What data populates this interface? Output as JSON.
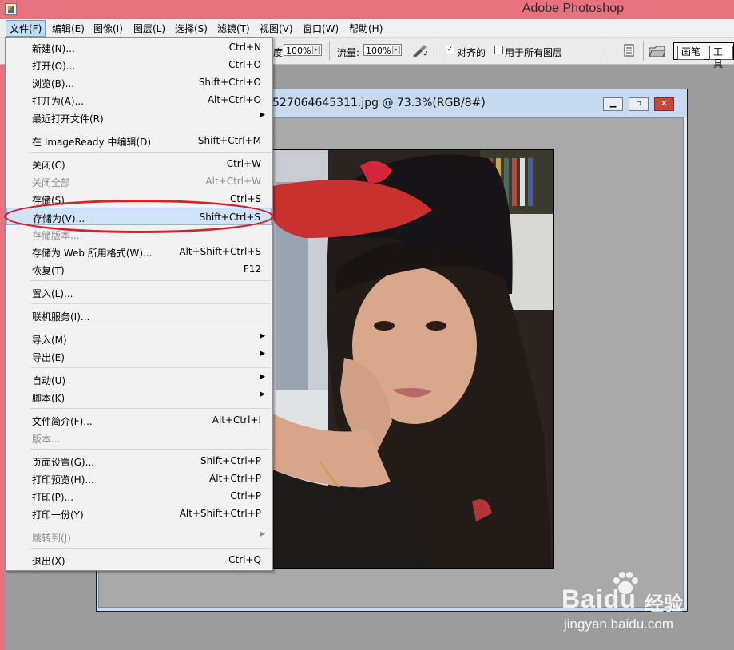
{
  "window": {
    "title": "Adobe Photoshop"
  },
  "menubar": [
    "文件(F)",
    "编辑(E)",
    "图像(I)",
    "图层(L)",
    "选择(S)",
    "滤镜(T)",
    "视图(V)",
    "窗口(W)",
    "帮助(H)"
  ],
  "options": {
    "opacity_label_fragment": "度:",
    "opacity_value": "100%",
    "flow_label": "流量:",
    "flow_value": "100%",
    "aligned_label": "对齐的",
    "aligned_checked": true,
    "all_layers_label": "用于所有图层",
    "all_layers_checked": false,
    "tabs": [
      "画笔",
      "工具"
    ]
  },
  "document": {
    "title": "527064645311.jpg @ 73.3%(RGB/8#)",
    "minimize_icon": "minimize-icon",
    "maximize_icon": "maximize-icon",
    "close_icon": "close-icon"
  },
  "file_menu": {
    "items": [
      {
        "label": "新建(N)...",
        "shortcut": "Ctrl+N"
      },
      {
        "label": "打开(O)...",
        "shortcut": "Ctrl+O"
      },
      {
        "label": "浏览(B)...",
        "shortcut": "Shift+Ctrl+O"
      },
      {
        "label": "打开为(A)...",
        "shortcut": "Alt+Ctrl+O"
      },
      {
        "label": "最近打开文件(R)",
        "shortcut": ""
      },
      {
        "label": "在 ImageReady 中编辑(D)",
        "shortcut": "Shift+Ctrl+M"
      },
      {
        "label": "关闭(C)",
        "shortcut": "Ctrl+W"
      },
      {
        "label": "关闭全部",
        "shortcut": "Alt+Ctrl+W"
      },
      {
        "label": "存储(S)",
        "shortcut": "Ctrl+S"
      },
      {
        "label": "存储为(V)...",
        "shortcut": "Shift+Ctrl+S"
      },
      {
        "label": "存储版本...",
        "shortcut": ""
      },
      {
        "label": "存储为 Web 所用格式(W)...",
        "shortcut": "Alt+Shift+Ctrl+S"
      },
      {
        "label": "恢复(T)",
        "shortcut": "F12"
      },
      {
        "label": "置入(L)...",
        "shortcut": ""
      },
      {
        "label": "联机服务(I)...",
        "shortcut": ""
      },
      {
        "label": "导入(M)",
        "shortcut": ""
      },
      {
        "label": "导出(E)",
        "shortcut": ""
      },
      {
        "label": "自动(U)",
        "shortcut": ""
      },
      {
        "label": "脚本(K)",
        "shortcut": ""
      },
      {
        "label": "文件简介(F)...",
        "shortcut": "Alt+Ctrl+I"
      },
      {
        "label": "版本...",
        "shortcut": ""
      },
      {
        "label": "页面设置(G)...",
        "shortcut": "Shift+Ctrl+P"
      },
      {
        "label": "打印预览(H)...",
        "shortcut": "Alt+Ctrl+P"
      },
      {
        "label": "打印(P)...",
        "shortcut": "Ctrl+P"
      },
      {
        "label": "打印一份(Y)",
        "shortcut": "Alt+Shift+Ctrl+P"
      },
      {
        "label": "跳转到(J)",
        "shortcut": ""
      },
      {
        "label": "退出(X)",
        "shortcut": "Ctrl+Q"
      }
    ],
    "highlighted": "存储为(V)..."
  },
  "watermark": {
    "brand": "Baidu",
    "cn": "经验",
    "url": "jingyan.baidu.com"
  },
  "colors": {
    "title_bar": "#e8717f",
    "menu_highlight": "#d1e3f8",
    "annotation": "#d4232b",
    "hat_brim": "#c8312e"
  }
}
